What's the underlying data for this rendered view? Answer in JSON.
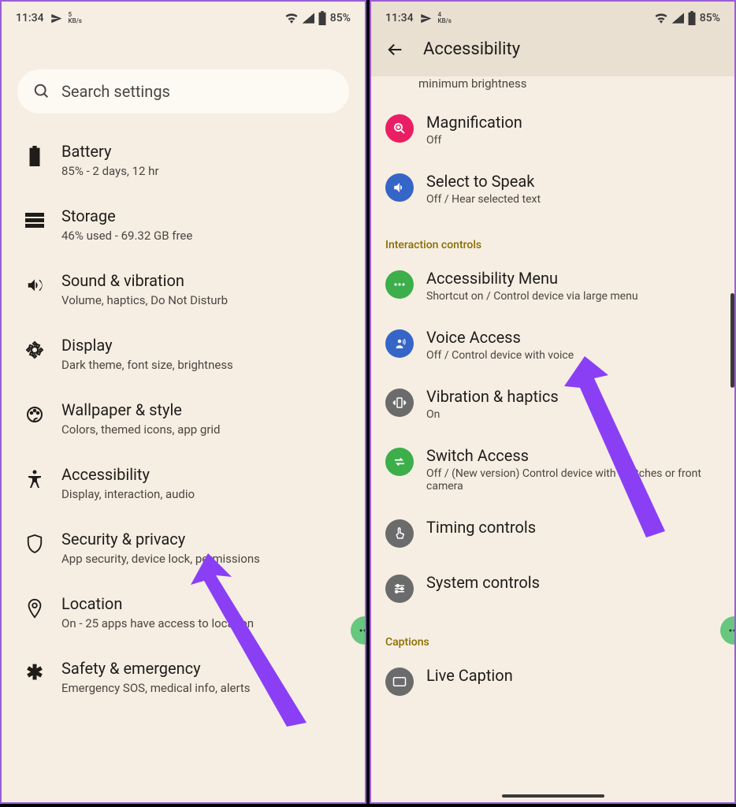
{
  "status": {
    "time": "11:34",
    "net_rate": "5",
    "net_unit": "KB/s",
    "battery": "85%"
  },
  "status2": {
    "time": "11:34",
    "net_rate": "4",
    "net_unit": "KB/s",
    "battery": "85%"
  },
  "search": {
    "placeholder": "Search settings"
  },
  "settings": [
    {
      "title": "Battery",
      "sub": "85% - 2 days, 12 hr"
    },
    {
      "title": "Storage",
      "sub": "46% used - 69.32 GB free"
    },
    {
      "title": "Sound & vibration",
      "sub": "Volume, haptics, Do Not Disturb"
    },
    {
      "title": "Display",
      "sub": "Dark theme, font size, brightness"
    },
    {
      "title": "Wallpaper & style",
      "sub": "Colors, themed icons, app grid"
    },
    {
      "title": "Accessibility",
      "sub": "Display, interaction, audio"
    },
    {
      "title": "Security & privacy",
      "sub": "App security, device lock, permissions"
    },
    {
      "title": "Location",
      "sub": "On - 25 apps have access to location"
    },
    {
      "title": "Safety & emergency",
      "sub": "Emergency SOS, medical info, alerts"
    }
  ],
  "screen2": {
    "title": "Accessibility",
    "partial_sub": "minimum brightness",
    "sections": {
      "top": [
        {
          "title": "Magnification",
          "sub": "Off",
          "color": "#e91e63",
          "icon": "zoom"
        },
        {
          "title": "Select to Speak",
          "sub": "Off / Hear selected text",
          "color": "#3565c7",
          "icon": "speaker"
        }
      ],
      "interaction_header": "Interaction controls",
      "interaction": [
        {
          "title": "Accessibility Menu",
          "sub": "Shortcut on / Control device via large menu",
          "color": "#3cae4a",
          "icon": "dots"
        },
        {
          "title": "Voice Access",
          "sub": "Off / Control device with voice",
          "color": "#3565c7",
          "icon": "voice"
        },
        {
          "title": "Vibration & haptics",
          "sub": "On",
          "color": "#6b6b6b",
          "icon": "vibrate"
        },
        {
          "title": "Switch Access",
          "sub": "Off / (New version) Control device with switches or front camera",
          "color": "#3cae4a",
          "icon": "switch"
        },
        {
          "title": "Timing controls",
          "sub": "",
          "color": "#6b6b6b",
          "icon": "touch"
        },
        {
          "title": "System controls",
          "sub": "",
          "color": "#6b6b6b",
          "icon": "sliders"
        }
      ],
      "captions_header": "Captions",
      "captions": [
        {
          "title": "Live Caption",
          "sub": "",
          "color": "#6b6b6b",
          "icon": "caption"
        }
      ]
    }
  }
}
